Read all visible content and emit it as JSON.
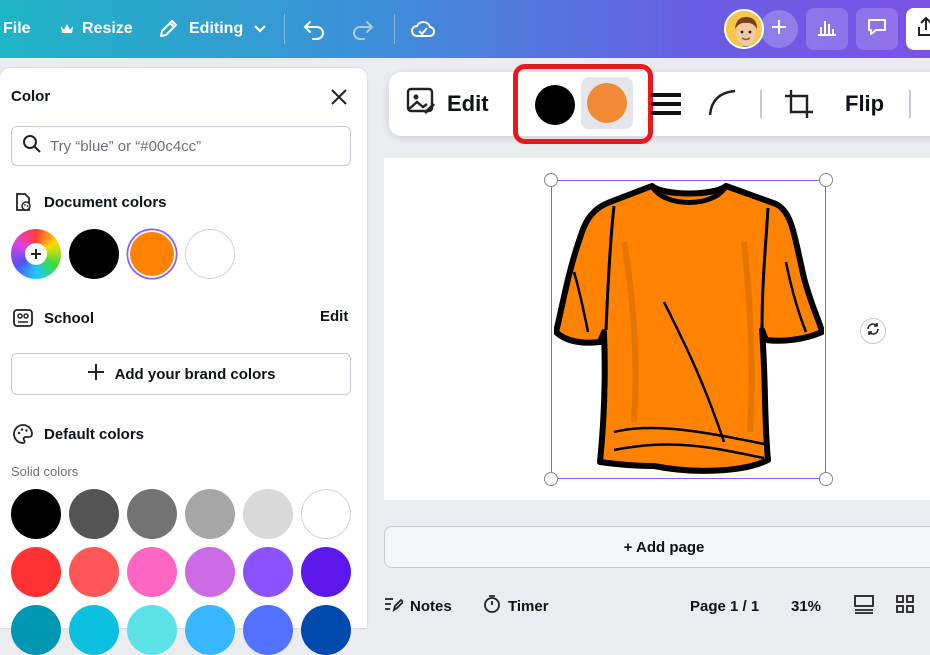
{
  "topbar": {
    "file_label": "File",
    "resize_label": "Resize",
    "editing_label": "Editing"
  },
  "color_panel": {
    "title": "Color",
    "search_placeholder": "Try “blue” or “#00c4cc”",
    "document_colors_label": "Document colors",
    "document_colors": [
      "#000000",
      "#ff8200",
      "#ffffff"
    ],
    "selected_document_color": "#ff8200",
    "school_label": "School",
    "school_edit_label": "Edit",
    "brand_button_label": "Add your brand colors",
    "default_colors_label": "Default colors",
    "solid_colors_label": "Solid colors",
    "solid_colors": [
      "#000000",
      "#545454",
      "#737373",
      "#a6a6a6",
      "#d9d9d9",
      "#ffffff",
      "#ff3131",
      "#ff5757",
      "#ff66c4",
      "#cb6ce6",
      "#8c52ff",
      "#5e17eb",
      "#0097b2",
      "#0cc0df",
      "#5ce1e6",
      "#38b6ff",
      "#5271ff",
      "#004aad"
    ]
  },
  "toolbar": {
    "edit_label": "Edit",
    "color_swatches": [
      "#000000",
      "#f08a36"
    ],
    "flip_label": "Flip",
    "highlight_color": "#e8181e"
  },
  "canvas": {
    "add_page_label": "+ Add page"
  },
  "bottombar": {
    "notes_label": "Notes",
    "timer_label": "Timer",
    "page_label": "Page 1 / 1",
    "zoom_label": "31%"
  },
  "colors": {
    "shirt": "#ff8200",
    "selection": "#8b5cf6"
  }
}
